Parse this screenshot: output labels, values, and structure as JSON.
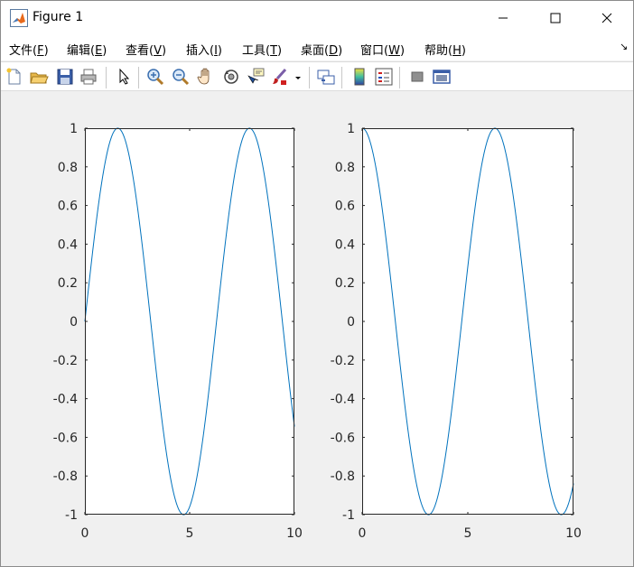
{
  "window": {
    "title": "Figure 1",
    "app_icon": "matlab-icon"
  },
  "menu": {
    "items": [
      {
        "label": "文件(",
        "key": "F",
        "suffix": ")"
      },
      {
        "label": "编辑(",
        "key": "E",
        "suffix": ")"
      },
      {
        "label": "查看(",
        "key": "V",
        "suffix": ")"
      },
      {
        "label": "插入(",
        "key": "I",
        "suffix": ")"
      },
      {
        "label": "工具(",
        "key": "T",
        "suffix": ")"
      },
      {
        "label": "桌面(",
        "key": "D",
        "suffix": ")"
      },
      {
        "label": "窗口(",
        "key": "W",
        "suffix": ")"
      },
      {
        "label": "帮助(",
        "key": "H",
        "suffix": ")"
      }
    ],
    "dock_arrow": "↘"
  },
  "toolbar": {
    "buttons": [
      "new-figure-icon",
      "open-file-icon",
      "save-icon",
      "print-icon",
      "edit-plot-arrow-icon",
      "zoom-in-icon",
      "zoom-out-icon",
      "pan-hand-icon",
      "rotate-3d-icon",
      "data-cursor-icon",
      "brush-icon",
      "link-plot-icon",
      "insert-colorbar-icon",
      "insert-legend-icon",
      "hide-plot-tools-icon",
      "show-plot-tools-icon"
    ]
  },
  "chart_data": [
    {
      "type": "line",
      "function": "sin(x)",
      "xlim": [
        0,
        10
      ],
      "ylim": [
        -1,
        1
      ],
      "xticks": [
        "0",
        "5",
        "10"
      ],
      "yticks": [
        "-1",
        "-0.8",
        "-0.6",
        "-0.4",
        "-0.2",
        "0",
        "0.2",
        "0.4",
        "0.6",
        "0.8",
        "1"
      ],
      "line_color": "#0072bd",
      "title": "",
      "xlabel": "",
      "ylabel": "",
      "grid": false
    },
    {
      "type": "line",
      "function": "cos(x)",
      "xlim": [
        0,
        10
      ],
      "ylim": [
        -1,
        1
      ],
      "xticks": [
        "0",
        "5",
        "10"
      ],
      "yticks": [
        "-1",
        "-0.8",
        "-0.6",
        "-0.4",
        "-0.2",
        "0",
        "0.2",
        "0.4",
        "0.6",
        "0.8",
        "1"
      ],
      "line_color": "#0072bd",
      "title": "",
      "xlabel": "",
      "ylabel": "",
      "grid": false
    }
  ]
}
